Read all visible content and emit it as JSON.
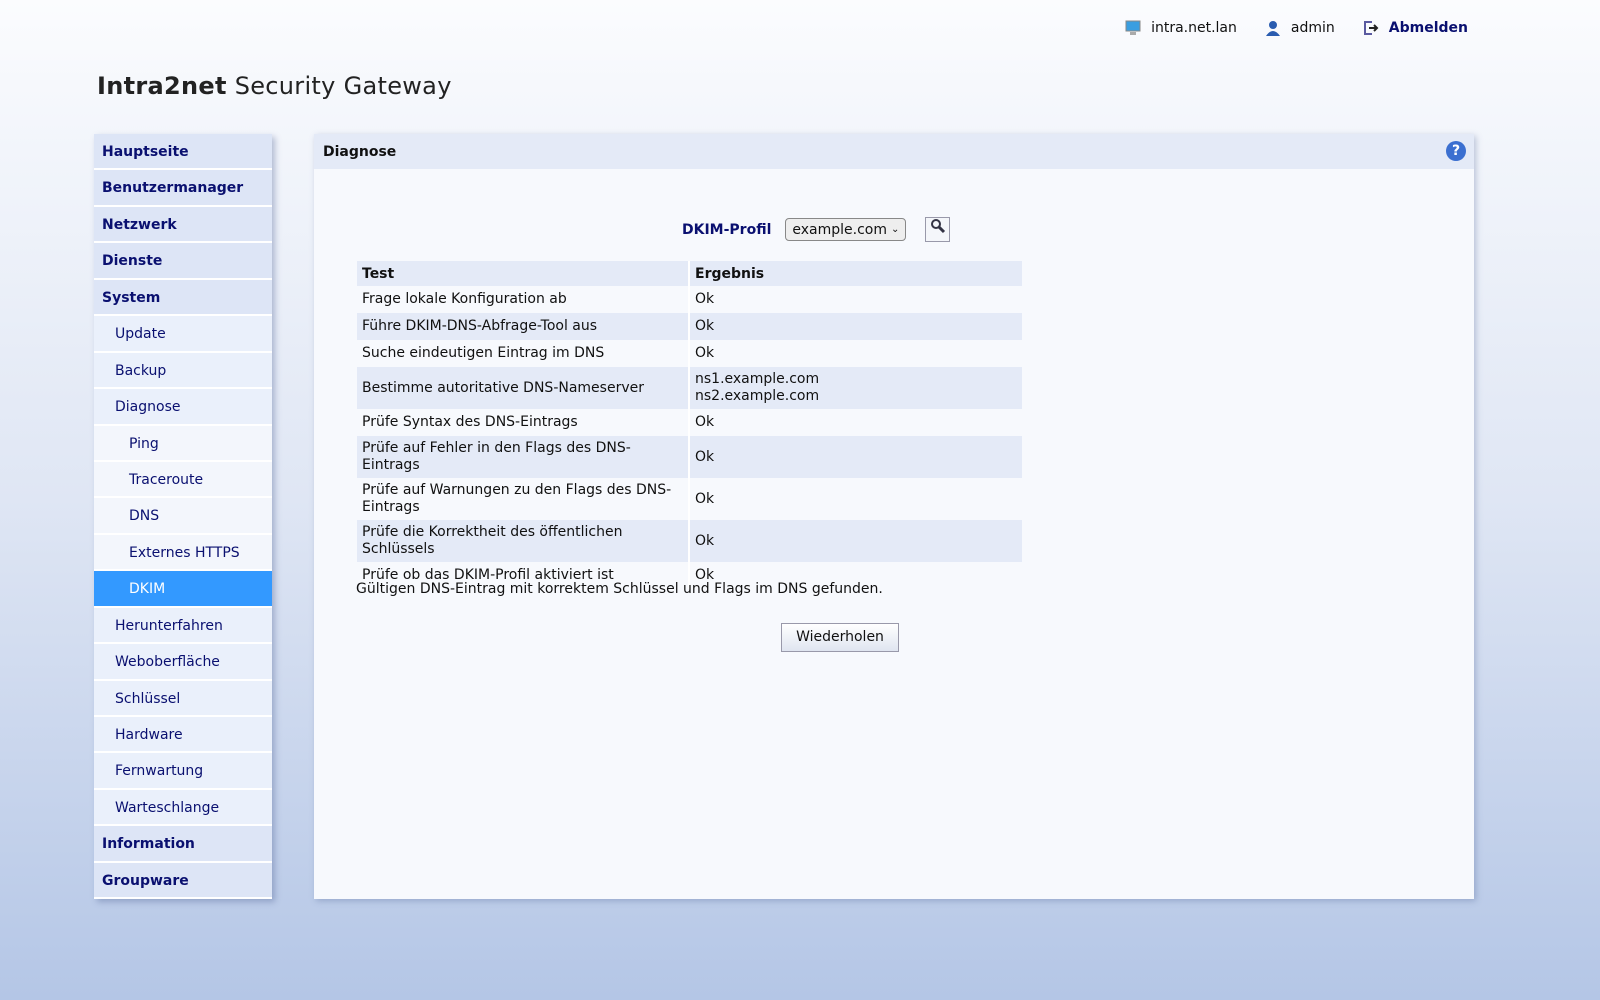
{
  "header": {
    "host": "intra.net.lan",
    "user": "admin",
    "logout": "Abmelden"
  },
  "logo": {
    "bold": "Intra2net",
    "rest": " Security Gateway"
  },
  "sidebar": [
    {
      "label": "Hauptseite",
      "level": 1
    },
    {
      "label": "Benutzermanager",
      "level": 1
    },
    {
      "label": "Netzwerk",
      "level": 1
    },
    {
      "label": "Dienste",
      "level": 1
    },
    {
      "label": "System",
      "level": 1
    },
    {
      "label": "Update",
      "level": 2
    },
    {
      "label": "Backup",
      "level": 2
    },
    {
      "label": "Diagnose",
      "level": 2
    },
    {
      "label": "Ping",
      "level": 3
    },
    {
      "label": "Traceroute",
      "level": 3
    },
    {
      "label": "DNS",
      "level": 3
    },
    {
      "label": "Externes HTTPS",
      "level": 3
    },
    {
      "label": "DKIM",
      "level": 3,
      "active": true
    },
    {
      "label": "Herunterfahren",
      "level": 2
    },
    {
      "label": "Weboberfläche",
      "level": 2
    },
    {
      "label": "Schlüssel",
      "level": 2
    },
    {
      "label": "Hardware",
      "level": 2
    },
    {
      "label": "Fernwartung",
      "level": 2
    },
    {
      "label": "Warteschlange",
      "level": 2
    },
    {
      "label": "Information",
      "level": 1
    },
    {
      "label": "Groupware",
      "level": 1
    }
  ],
  "main": {
    "title": "Diagnose",
    "help": "?",
    "profile_label": "DKIM-Profil",
    "profile_value": "example.com",
    "columns": [
      "Test",
      "Ergebnis"
    ],
    "rows": [
      [
        "Frage lokale Konfiguration ab",
        "Ok"
      ],
      [
        "Führe DKIM-DNS-Abfrage-Tool aus",
        "Ok"
      ],
      [
        "Suche eindeutigen Eintrag im DNS",
        "Ok"
      ],
      [
        "Bestimme autoritative DNS-Nameserver",
        "ns1.example.com\nns2.example.com"
      ],
      [
        "Prüfe Syntax des DNS-Eintrags",
        "Ok"
      ],
      [
        "Prüfe auf Fehler in den Flags des DNS-Eintrags",
        "Ok"
      ],
      [
        "Prüfe auf Warnungen zu den Flags des DNS-Eintrags",
        "Ok"
      ],
      [
        "Prüfe die Korrektheit des öffentlichen Schlüssels",
        "Ok"
      ],
      [
        "Prüfe ob das DKIM-Profil aktiviert ist",
        "Ok"
      ]
    ],
    "message": "Gültigen DNS-Eintrag mit korrektem Schlüssel und Flags im DNS gefunden.",
    "retry": "Wiederholen"
  }
}
